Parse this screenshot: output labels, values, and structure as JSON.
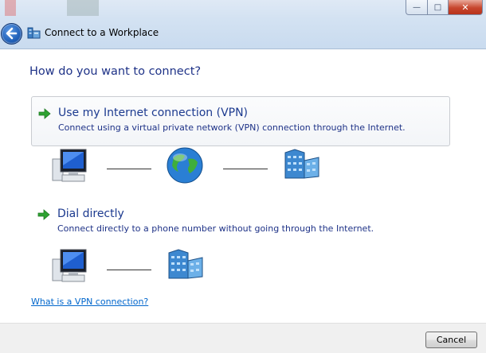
{
  "window": {
    "title": "Connect to a Workplace",
    "controls": {
      "minimize": "—",
      "maximize": "□",
      "close": "✕"
    }
  },
  "main": {
    "heading": "How do you want to connect?",
    "options": [
      {
        "title": "Use my Internet connection (VPN)",
        "description": "Connect using a virtual private network (VPN) connection through the Internet."
      },
      {
        "title": "Dial directly",
        "description": "Connect directly to a phone number without going through the Internet."
      }
    ],
    "help_link": "What is a VPN connection?"
  },
  "footer": {
    "cancel_label": "Cancel"
  },
  "colors": {
    "heading": "#1e3287",
    "link": "#0066cc",
    "arrow": "#2ea232",
    "titlebar": "#d3e2f2"
  }
}
